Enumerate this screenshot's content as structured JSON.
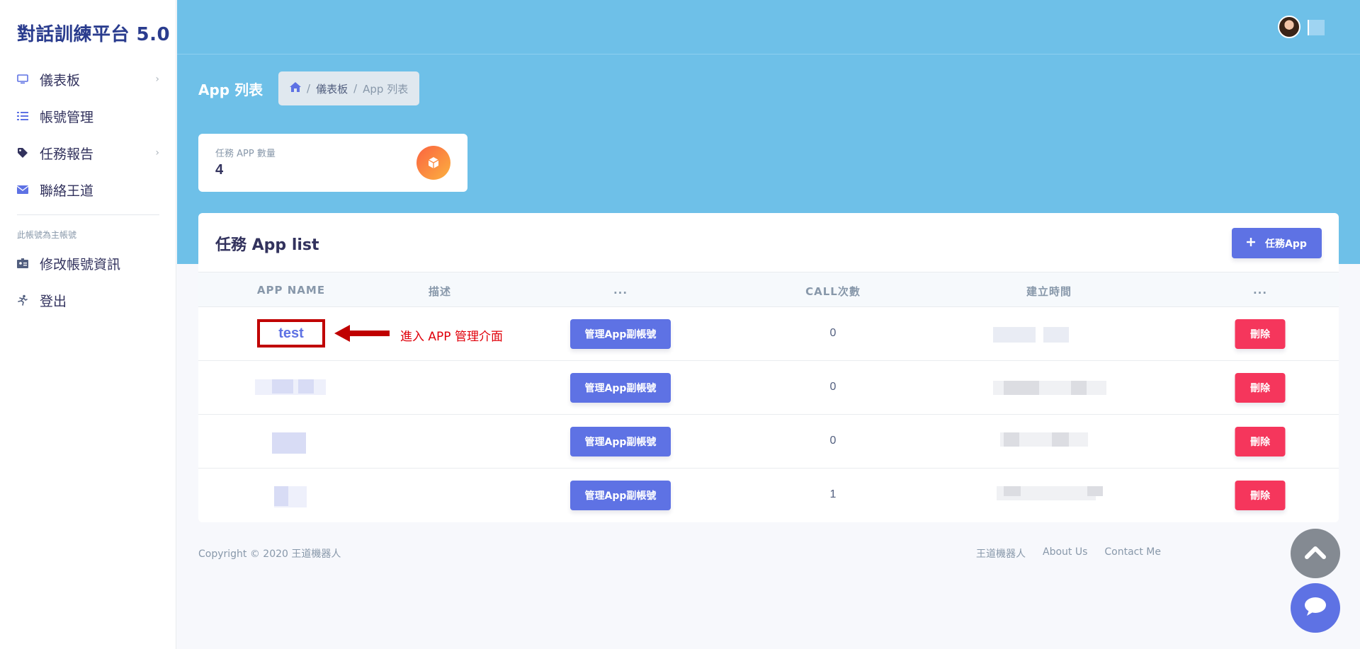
{
  "sidebar": {
    "brand": "對話訓練平台 5.0",
    "items": [
      {
        "label": "儀表板",
        "icon": "monitor-icon",
        "has_chevron": true
      },
      {
        "label": "帳號管理",
        "icon": "list-icon",
        "has_chevron": false
      },
      {
        "label": "任務報告",
        "icon": "tag-icon",
        "has_chevron": true
      },
      {
        "label": "聯絡王道",
        "icon": "envelope-icon",
        "has_chevron": false
      }
    ],
    "heading": "此帳號為主帳號",
    "items2": [
      {
        "label": "修改帳號資訊",
        "icon": "id-card-icon"
      },
      {
        "label": "登出",
        "icon": "running-icon"
      }
    ]
  },
  "header": {
    "page_title": "App 列表",
    "breadcrumb": {
      "home_icon": "home-icon",
      "level1": "儀表板",
      "sep": "/",
      "current": "App 列表"
    }
  },
  "stat": {
    "label": "任務 APP 數量",
    "value": "4",
    "icon": "box-icon"
  },
  "table": {
    "title": "任務 App list",
    "add_button": "任務App",
    "add_icon": "plus-icon",
    "columns": [
      "APP NAME",
      "描述",
      "...",
      "CALL次數",
      "建立時間",
      "..."
    ],
    "rows": [
      {
        "app_name": "test",
        "manage": "管理App副帳號",
        "calls": "0",
        "delete": "刪除"
      },
      {
        "app_name": "",
        "manage": "管理App副帳號",
        "calls": "0",
        "delete": "刪除"
      },
      {
        "app_name": "",
        "manage": "管理App副帳號",
        "calls": "0",
        "delete": "刪除"
      },
      {
        "app_name": "",
        "manage": "管理App副帳號",
        "calls": "1",
        "delete": "刪除"
      }
    ],
    "annotation": "進入 APP 管理介面"
  },
  "footer": {
    "copyright": "Copyright © 2020 王道機器人",
    "links": [
      "王道機器人",
      "About Us",
      "Contact Me"
    ]
  },
  "colors": {
    "primary": "#5e72e4",
    "danger": "#f5365c",
    "header": "#6ec0e8",
    "annotation": "#e0000a"
  }
}
